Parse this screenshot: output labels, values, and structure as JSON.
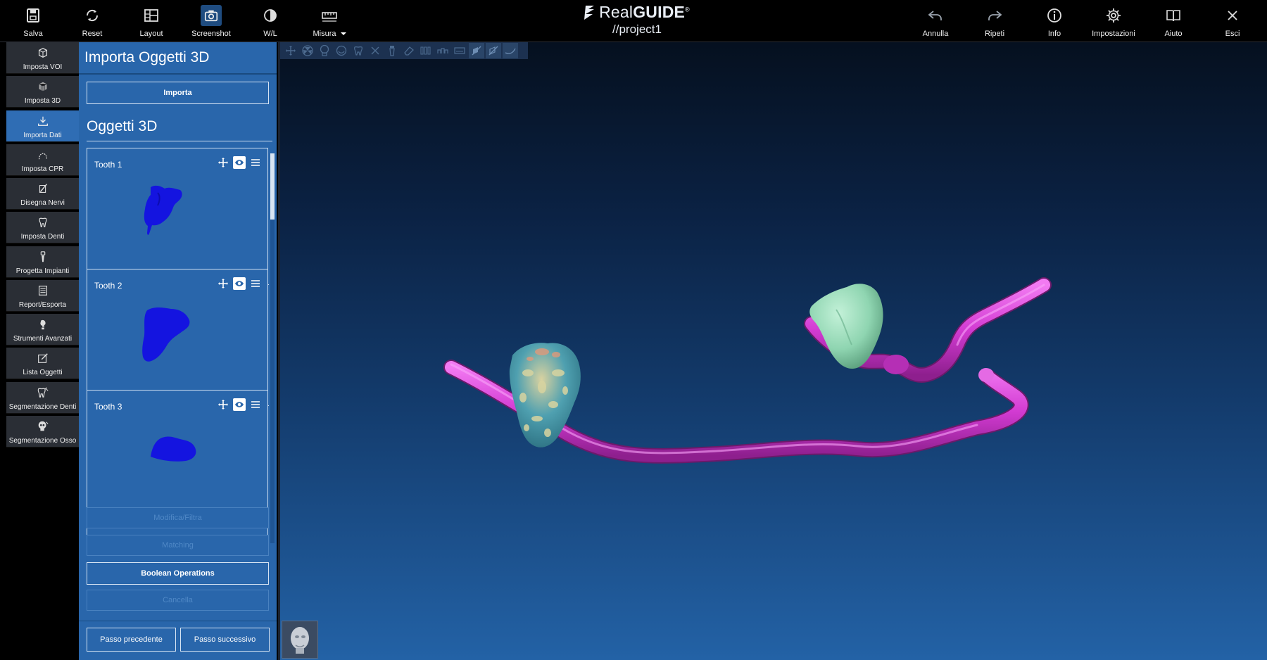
{
  "app": {
    "brand_prefix": "Real",
    "brand_suffix": "GUIDE",
    "brand_mark": "®",
    "project": "//project1"
  },
  "toolbar": {
    "left": [
      {
        "id": "save",
        "label": "Salva",
        "icon": "save-icon"
      },
      {
        "id": "reset",
        "label": "Reset",
        "icon": "reset-icon"
      },
      {
        "id": "layout",
        "label": "Layout",
        "icon": "layout-icon"
      },
      {
        "id": "screenshot",
        "label": "Screenshot",
        "icon": "camera-icon",
        "active": true
      },
      {
        "id": "wl",
        "label": "W/L",
        "icon": "contrast-icon"
      },
      {
        "id": "measure",
        "label": "Misura",
        "icon": "ruler-icon",
        "dropdown": true
      }
    ],
    "right": [
      {
        "id": "undo",
        "label": "Annulla",
        "icon": "undo-icon"
      },
      {
        "id": "redo",
        "label": "Ripeti",
        "icon": "redo-icon"
      },
      {
        "id": "info",
        "label": "Info",
        "icon": "info-icon"
      },
      {
        "id": "settings",
        "label": "Impostazioni",
        "icon": "gear-icon"
      },
      {
        "id": "help",
        "label": "Aiuto",
        "icon": "book-icon"
      },
      {
        "id": "exit",
        "label": "Esci",
        "icon": "close-icon"
      }
    ]
  },
  "steps": [
    {
      "label": "Imposta VOI",
      "icon": "voi-cube-icon"
    },
    {
      "label": "Imposta 3D",
      "icon": "volume-3d-icon"
    },
    {
      "label": "Importa Dati",
      "icon": "import-icon",
      "active": true
    },
    {
      "label": "Imposta CPR",
      "icon": "arch-curve-icon"
    },
    {
      "label": "Disegna Nervi",
      "icon": "nerve-pen-icon"
    },
    {
      "label": "Imposta Denti",
      "icon": "tooth-icon"
    },
    {
      "label": "Progetta Impianti",
      "icon": "implant-icon"
    },
    {
      "label": "Report/Esporta",
      "icon": "report-icon"
    },
    {
      "label": "Strumenti Avanzati",
      "icon": "advanced-tools-icon"
    },
    {
      "label": "Lista Oggetti",
      "icon": "object-list-icon"
    },
    {
      "label": "Segmentazione Denti",
      "icon": "tooth-segmentation-icon"
    },
    {
      "label": "Segmentazione Osso",
      "icon": "skull-segmentation-icon"
    }
  ],
  "panel": {
    "title": "Importa Oggetti 3D",
    "import_button": "Importa",
    "objects_title": "Oggetti 3D",
    "objects": [
      {
        "name": "Tooth 1",
        "color": "#1414e0",
        "visible": true
      },
      {
        "name": "Tooth 2",
        "color": "#1414e0",
        "visible": true
      },
      {
        "name": "Tooth 3",
        "color": "#1414e0",
        "visible": true
      }
    ],
    "actions": [
      {
        "label": "Modifica/Filtra",
        "enabled": false
      },
      {
        "label": "Matching",
        "enabled": false
      },
      {
        "label": "Boolean Operations",
        "enabled": true
      },
      {
        "label": "Cancella",
        "enabled": false
      }
    ],
    "prev_button": "Passo precedente",
    "next_button": "Passo successivo"
  },
  "viewport": {
    "tools": [
      "move-icon",
      "radiation-icon",
      "skull-icon",
      "jaw-icon",
      "tooth-outline-icon",
      "cross-icon",
      "implant-tool-icon",
      "eraser-icon",
      "teeth-row-icon",
      "arch-icon",
      "panorama-icon",
      "cut-plane-icon",
      "cut-plane-alt-icon",
      "curve-icon"
    ],
    "colors": {
      "nerve": "#d83ad8",
      "tooth_green": "#8ed6b0",
      "tooth_cyan": "#4fa0b0",
      "accent": "#2966ab"
    }
  }
}
